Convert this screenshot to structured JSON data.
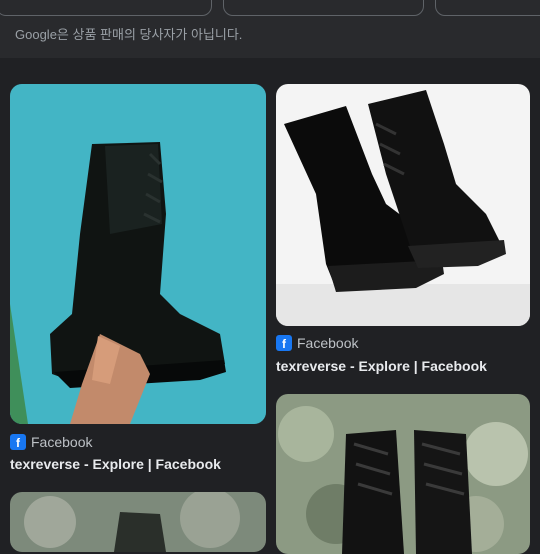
{
  "disclaimer": "Google은 상품 판매의 당사자가 아닙니다.",
  "colors": {
    "background": "#202124",
    "facebook": "#1877f2"
  },
  "results": [
    {
      "source": "Facebook",
      "source_icon": "facebook-icon",
      "title": "texreverse - Explore | Facebook"
    },
    {
      "source": "Facebook",
      "source_icon": "facebook-icon",
      "title": "texreverse - Explore | Facebook"
    }
  ]
}
